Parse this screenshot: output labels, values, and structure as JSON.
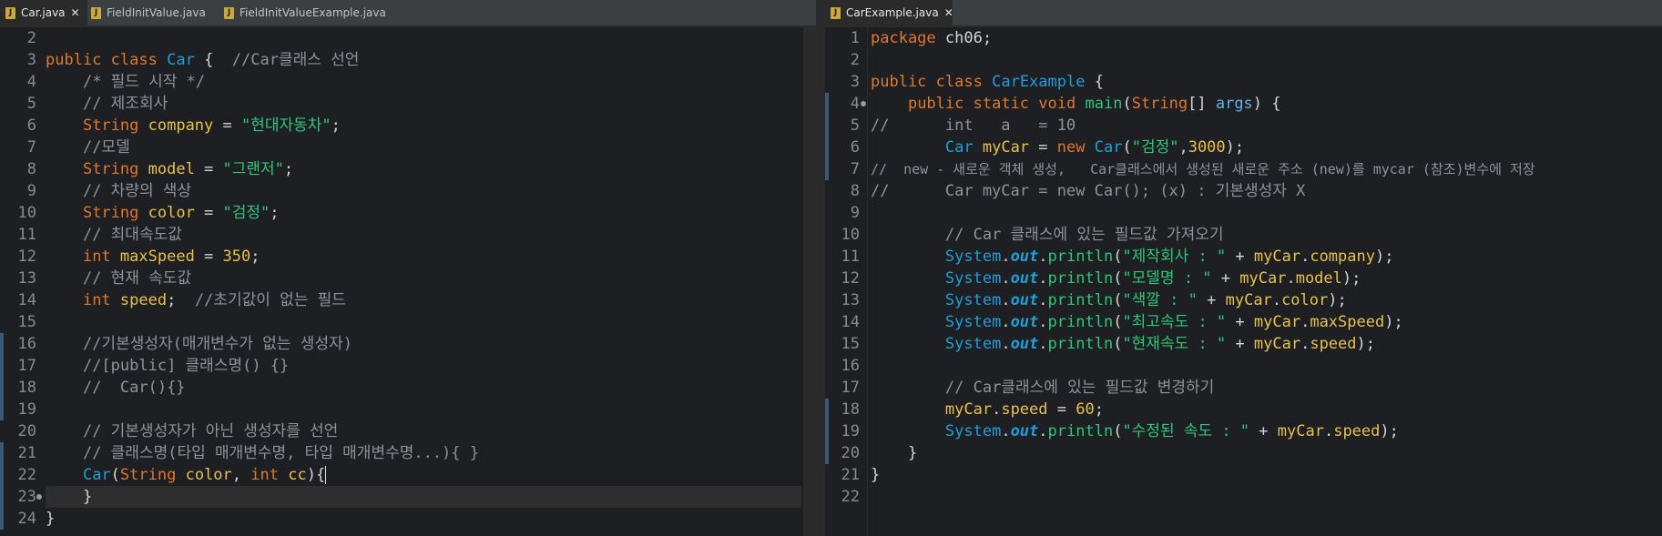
{
  "left_editor": {
    "tabs": [
      {
        "icon": "J",
        "label": "Car.java",
        "close": "✕",
        "active": true
      },
      {
        "icon": "J",
        "label": "FieldInitValue.java",
        "close": "",
        "active": false
      },
      {
        "icon": "J",
        "label": "FieldInitValueExample.java",
        "close": "",
        "active": false
      }
    ],
    "lines": [
      {
        "n": "2",
        "code": ""
      },
      {
        "n": "3",
        "code": "public class Car {  //Car클래스 선언"
      },
      {
        "n": "4",
        "code": "    /* 필드 시작 */"
      },
      {
        "n": "5",
        "code": "    // 제조회사"
      },
      {
        "n": "6",
        "code": "    String company = \"현대자동차\";"
      },
      {
        "n": "7",
        "code": "    //모델"
      },
      {
        "n": "8",
        "code": "    String model = \"그랜저\";"
      },
      {
        "n": "9",
        "code": "    // 차량의 색상"
      },
      {
        "n": "10",
        "code": "    String color = \"검정\";"
      },
      {
        "n": "11",
        "code": "    // 최대속도값"
      },
      {
        "n": "12",
        "code": "    int maxSpeed = 350;"
      },
      {
        "n": "13",
        "code": "    // 현재 속도값"
      },
      {
        "n": "14",
        "code": "    int speed;  //초기값이 없는 필드"
      },
      {
        "n": "15",
        "code": ""
      },
      {
        "n": "16",
        "code": "    //기본생성자(매개변수가 없는 생성자)"
      },
      {
        "n": "17",
        "code": "    //[public] 클래스명() {}"
      },
      {
        "n": "18",
        "code": "    //  Car(){}"
      },
      {
        "n": "19",
        "code": ""
      },
      {
        "n": "20",
        "code": "    // 기본생성자가 아닌 생성자를 선언"
      },
      {
        "n": "21",
        "code": "    // 클래스명(타입 매개변수명, 타입 매개변수명...){ }"
      },
      {
        "n": "22",
        "code": "    Car(String color, int cc){"
      },
      {
        "n": "23",
        "code": "    }"
      },
      {
        "n": "24",
        "code": "}"
      }
    ]
  },
  "right_editor": {
    "tabs": [
      {
        "icon": "J",
        "label": "CarExample.java",
        "close": "✕",
        "active": true
      }
    ],
    "lines": [
      {
        "n": "1",
        "code": "package ch06;"
      },
      {
        "n": "2",
        "code": ""
      },
      {
        "n": "3",
        "code": "public class CarExample {"
      },
      {
        "n": "4",
        "code": "    public static void main(String[] args) {"
      },
      {
        "n": "5",
        "code": "//      int   a   = 10"
      },
      {
        "n": "6",
        "code": "        Car myCar = new Car(\"검정\",3000);"
      },
      {
        "n": "7",
        "code": "//  new - 새로운 객체 생성,   Car클래스에서 생성된 새로운 주소 (new)를 mycar (참조)변수에 저장"
      },
      {
        "n": "8",
        "code": "//      Car myCar = new Car(); (x) : 기본생성자 X"
      },
      {
        "n": "9",
        "code": ""
      },
      {
        "n": "10",
        "code": "        // Car 클래스에 있는 필드값 가져오기"
      },
      {
        "n": "11",
        "code": "        System.out.println(\"제작회사 : \" + myCar.company);"
      },
      {
        "n": "12",
        "code": "        System.out.println(\"모델명 : \" + myCar.model);"
      },
      {
        "n": "13",
        "code": "        System.out.println(\"색깔 : \" + myCar.color);"
      },
      {
        "n": "14",
        "code": "        System.out.println(\"최고속도 : \" + myCar.maxSpeed);"
      },
      {
        "n": "15",
        "code": "        System.out.println(\"현재속도 : \" + myCar.speed);"
      },
      {
        "n": "16",
        "code": ""
      },
      {
        "n": "17",
        "code": "        // Car클래스에 있는 필드값 변경하기"
      },
      {
        "n": "18",
        "code": "        myCar.speed = 60;"
      },
      {
        "n": "19",
        "code": "        System.out.println(\"수정된 속도 : \" + myCar.speed);"
      },
      {
        "n": "20",
        "code": "    }"
      },
      {
        "n": "21",
        "code": "}"
      },
      {
        "n": "22",
        "code": ""
      }
    ]
  },
  "colors": {
    "keyword": "#e0772e",
    "type": "#1e9fd8",
    "string": "#2ec77a",
    "number": "#e7c14a",
    "comment": "#8d9399"
  }
}
